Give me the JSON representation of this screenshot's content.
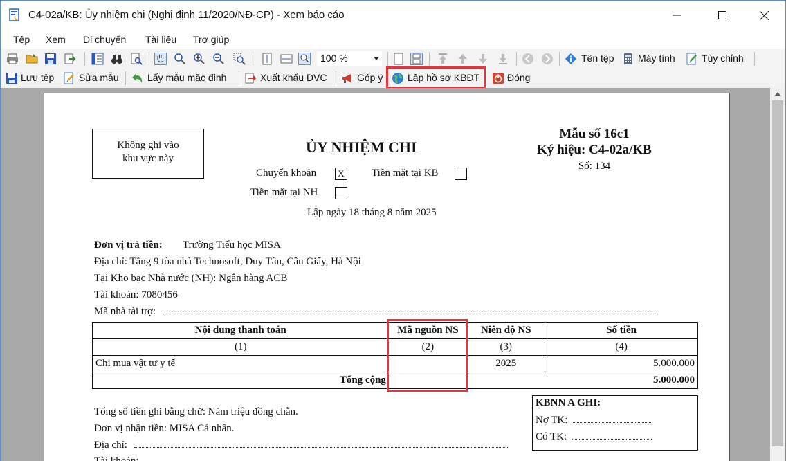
{
  "window": {
    "title": "C4-02a/KB: Ủy nhiệm chi (Nghị định 11/2020/NĐ-CP) - Xem báo cáo"
  },
  "menu": [
    "Tệp",
    "Xem",
    "Di chuyển",
    "Tài liệu",
    "Trợ giúp"
  ],
  "toolbar1": {
    "zoom": "100 %",
    "file_name_label": "Tên tệp",
    "calculator_label": "Máy tính",
    "customize_label": "Tùy chỉnh"
  },
  "toolbar2": {
    "save_label": "Lưu tệp",
    "edit_template_label": "Sửa mẫu",
    "default_template_label": "Lấy mẫu mặc định",
    "export_label": "Xuất khẩu DVC",
    "feedback_label": "Góp ý",
    "create_record_label": "Lập hồ sơ KBĐT",
    "close_label": "Đóng"
  },
  "colors": {
    "highlight": "#e8333a",
    "viewer_bg": "#a9a9a9"
  },
  "document": {
    "no_write_box": [
      "Không ghi vào",
      "khu vực này"
    ],
    "title": "ỦY NHIỆM CHI",
    "form_no": "Mẫu số 16c1",
    "symbol": "Ký hiệu: C4-02a/KB",
    "number": "Số: 134",
    "transfer_label": "Chuyển khoản",
    "transfer_mark": "X",
    "cash_kb_label": "Tiền mặt tại KB",
    "cash_nh_label": "Tiền mặt tại NH",
    "date": "Lập ngày 18 tháng 8 năm 2025",
    "payer_label": "Đơn vị trả tiền:",
    "payer_name": "Trường Tiểu học MISA",
    "address": "Địa chỉ: Tầng 9 tòa nhà Technosoft, Duy Tân, Cầu Giấy, Hà Nội",
    "treasury": "Tại Kho bạc Nhà nước (NH): Ngân hàng ACB",
    "account": "Tài khoản: 7080456",
    "sponsor_code": "Mã nhà tài trợ:",
    "table": {
      "headers": [
        "Nội dung thanh toán",
        "Mã nguồn NS",
        "Niên độ NS",
        "Số tiền"
      ],
      "col_numbers": [
        "(1)",
        "(2)",
        "(3)",
        "(4)"
      ],
      "row": {
        "content": "Chi mua vật tư y tế",
        "source": "",
        "year": "2025",
        "amount": "5.000.000"
      },
      "total_label": "Tổng cộng",
      "total_amount": "5.000.000"
    },
    "amount_in_words": "Tổng số tiền ghi bằng chữ: Năm triệu đồng chẵn.",
    "receiver": "Đơn vị nhận tiền: MISA Cá nhân.",
    "receiver_address": "Địa chỉ:",
    "receiver_account": "Tài khoản:",
    "kbnn_title": "KBNN A GHI:",
    "debit": "Nợ TK:",
    "credit": "Có TK:"
  }
}
